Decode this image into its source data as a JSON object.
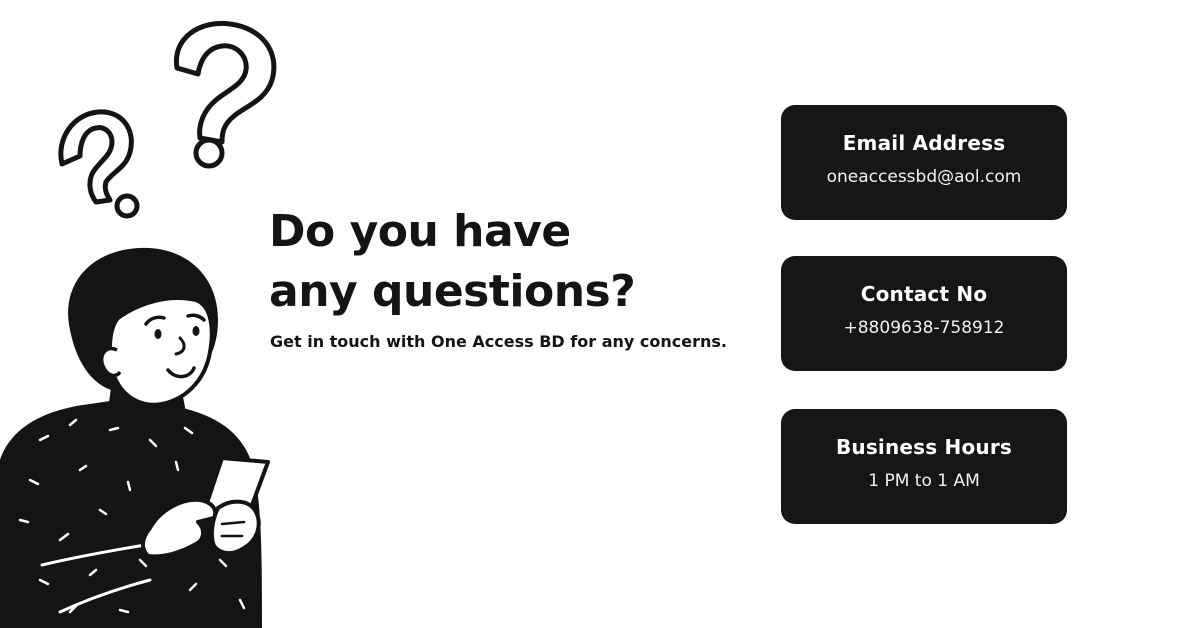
{
  "heading": {
    "line1": "Do you have",
    "line2": "any questions?"
  },
  "subtitle": "Get in touch with One Access BD for any concerns.",
  "cards": [
    {
      "title": "Email Address",
      "value": "oneaccessbd@aol.com"
    },
    {
      "title": "Contact No",
      "value": "+8809638-758912"
    },
    {
      "title": "Business Hours",
      "value": "1 PM to 1 AM"
    }
  ],
  "colors": {
    "background": "#ffffff",
    "card_background": "#161616",
    "card_text": "#ffffff",
    "ink": "#141414"
  },
  "illustration": {
    "icons": [
      "question-mark-icon",
      "person-with-phone-illustration"
    ]
  }
}
